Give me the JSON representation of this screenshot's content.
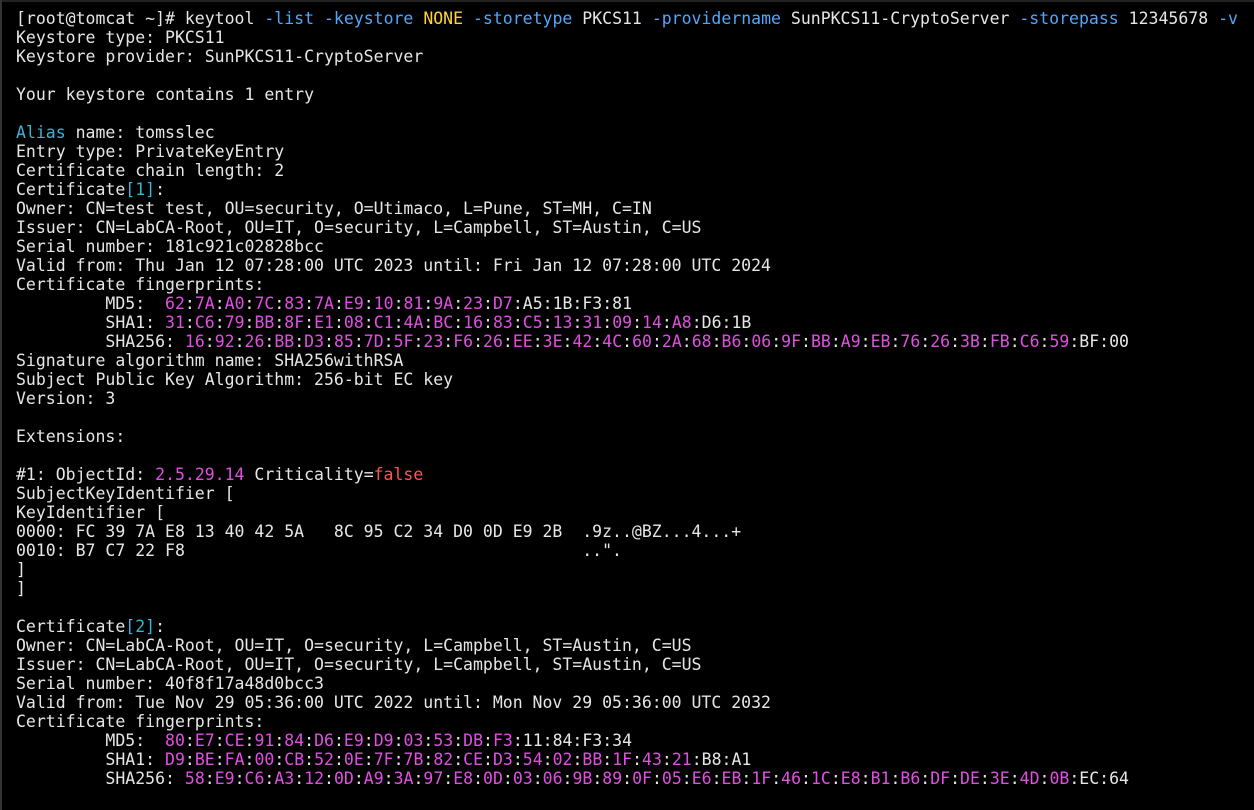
{
  "colors": {
    "background": "#000000",
    "text": "#e6e6e6",
    "option": "#4fa8ff",
    "keyword": "#38b6d8",
    "hex": "#e14fe1",
    "bool": "#ff5555",
    "value": "#ffd23a"
  },
  "terminal": {
    "lines": [
      [
        [
          "plain",
          "[root@tomcat ~]# keytool "
        ],
        [
          "blue",
          "-list -keystore "
        ],
        [
          "yellow",
          "NONE "
        ],
        [
          "blue",
          "-storetype "
        ],
        [
          "plain",
          "PKCS11 "
        ],
        [
          "blue",
          "-providername "
        ],
        [
          "plain",
          "SunPKCS11-CryptoServer "
        ],
        [
          "blue",
          "-storepass "
        ],
        [
          "plain",
          "12345678 "
        ],
        [
          "blue",
          "-v"
        ]
      ],
      [
        [
          "plain",
          "Keystore type: PKCS11"
        ]
      ],
      [
        [
          "plain",
          "Keystore provider: SunPKCS11-CryptoServer"
        ]
      ],
      [
        [
          "plain",
          ""
        ]
      ],
      [
        [
          "plain",
          "Your keystore contains 1 entry"
        ]
      ],
      [
        [
          "plain",
          ""
        ]
      ],
      [
        [
          "cyan",
          "Alias"
        ],
        [
          "plain",
          " name: tomsslec"
        ]
      ],
      [
        [
          "plain",
          "Entry type: PrivateKeyEntry"
        ]
      ],
      [
        [
          "plain",
          "Certificate chain length: 2"
        ]
      ],
      [
        [
          "plain",
          "Certificate"
        ],
        [
          "cyan",
          "[1]"
        ],
        [
          "plain",
          ":"
        ]
      ],
      [
        [
          "plain",
          "Owner: CN=test test, OU=security, O=Utimaco, L=Pune, ST=MH, C=IN"
        ]
      ],
      [
        [
          "plain",
          "Issuer: CN=LabCA-Root, OU=IT, O=security, L=Campbell, ST=Austin, C=US"
        ]
      ],
      [
        [
          "plain",
          "Serial number: 181c921c02828bcc"
        ]
      ],
      [
        [
          "plain",
          "Valid from: Thu Jan 12 07:28:00 UTC 2023 until: Fri Jan 12 07:28:00 UTC 2024"
        ]
      ],
      [
        [
          "plain",
          "Certificate fingerprints:"
        ]
      ],
      [
        [
          "plain",
          "         MD5:  "
        ],
        [
          "magenta",
          "62"
        ],
        [
          "plain",
          ":"
        ],
        [
          "magenta",
          "7A"
        ],
        [
          "plain",
          ":"
        ],
        [
          "magenta",
          "A0"
        ],
        [
          "plain",
          ":"
        ],
        [
          "magenta",
          "7C"
        ],
        [
          "plain",
          ":"
        ],
        [
          "magenta",
          "83"
        ],
        [
          "plain",
          ":"
        ],
        [
          "magenta",
          "7A"
        ],
        [
          "plain",
          ":"
        ],
        [
          "magenta",
          "E9"
        ],
        [
          "plain",
          ":"
        ],
        [
          "magenta",
          "10"
        ],
        [
          "plain",
          ":"
        ],
        [
          "magenta",
          "81"
        ],
        [
          "plain",
          ":"
        ],
        [
          "magenta",
          "9A"
        ],
        [
          "plain",
          ":"
        ],
        [
          "magenta",
          "23"
        ],
        [
          "plain",
          ":"
        ],
        [
          "magenta",
          "D7"
        ],
        [
          "plain",
          ":A5:1B:F3:81"
        ]
      ],
      [
        [
          "plain",
          "         SHA1: "
        ],
        [
          "magenta",
          "31"
        ],
        [
          "plain",
          ":"
        ],
        [
          "magenta",
          "C6"
        ],
        [
          "plain",
          ":"
        ],
        [
          "magenta",
          "79"
        ],
        [
          "plain",
          ":"
        ],
        [
          "magenta",
          "BB"
        ],
        [
          "plain",
          ":"
        ],
        [
          "magenta",
          "8F"
        ],
        [
          "plain",
          ":"
        ],
        [
          "magenta",
          "E1"
        ],
        [
          "plain",
          ":"
        ],
        [
          "magenta",
          "08"
        ],
        [
          "plain",
          ":"
        ],
        [
          "magenta",
          "C1"
        ],
        [
          "plain",
          ":"
        ],
        [
          "magenta",
          "4A"
        ],
        [
          "plain",
          ":"
        ],
        [
          "magenta",
          "BC"
        ],
        [
          "plain",
          ":"
        ],
        [
          "magenta",
          "16"
        ],
        [
          "plain",
          ":"
        ],
        [
          "magenta",
          "83"
        ],
        [
          "plain",
          ":"
        ],
        [
          "magenta",
          "C5"
        ],
        [
          "plain",
          ":"
        ],
        [
          "magenta",
          "13"
        ],
        [
          "plain",
          ":"
        ],
        [
          "magenta",
          "31"
        ],
        [
          "plain",
          ":"
        ],
        [
          "magenta",
          "09"
        ],
        [
          "plain",
          ":"
        ],
        [
          "magenta",
          "14"
        ],
        [
          "plain",
          ":"
        ],
        [
          "magenta",
          "A8"
        ],
        [
          "plain",
          ":D6:1B"
        ]
      ],
      [
        [
          "plain",
          "         SHA256: "
        ],
        [
          "magenta",
          "16"
        ],
        [
          "plain",
          ":"
        ],
        [
          "magenta",
          "92"
        ],
        [
          "plain",
          ":"
        ],
        [
          "magenta",
          "26"
        ],
        [
          "plain",
          ":"
        ],
        [
          "magenta",
          "BB"
        ],
        [
          "plain",
          ":"
        ],
        [
          "magenta",
          "D3"
        ],
        [
          "plain",
          ":"
        ],
        [
          "magenta",
          "85"
        ],
        [
          "plain",
          ":"
        ],
        [
          "magenta",
          "7D"
        ],
        [
          "plain",
          ":"
        ],
        [
          "magenta",
          "5F"
        ],
        [
          "plain",
          ":"
        ],
        [
          "magenta",
          "23"
        ],
        [
          "plain",
          ":"
        ],
        [
          "magenta",
          "F6"
        ],
        [
          "plain",
          ":"
        ],
        [
          "magenta",
          "26"
        ],
        [
          "plain",
          ":"
        ],
        [
          "magenta",
          "EE"
        ],
        [
          "plain",
          ":"
        ],
        [
          "magenta",
          "3E"
        ],
        [
          "plain",
          ":"
        ],
        [
          "magenta",
          "42"
        ],
        [
          "plain",
          ":"
        ],
        [
          "magenta",
          "4C"
        ],
        [
          "plain",
          ":"
        ],
        [
          "magenta",
          "60"
        ],
        [
          "plain",
          ":"
        ],
        [
          "magenta",
          "2A"
        ],
        [
          "plain",
          ":"
        ],
        [
          "magenta",
          "68"
        ],
        [
          "plain",
          ":"
        ],
        [
          "magenta",
          "B6"
        ],
        [
          "plain",
          ":"
        ],
        [
          "magenta",
          "06"
        ],
        [
          "plain",
          ":"
        ],
        [
          "magenta",
          "9F"
        ],
        [
          "plain",
          ":"
        ],
        [
          "magenta",
          "BB"
        ],
        [
          "plain",
          ":"
        ],
        [
          "magenta",
          "A9"
        ],
        [
          "plain",
          ":"
        ],
        [
          "magenta",
          "EB"
        ],
        [
          "plain",
          ":"
        ],
        [
          "magenta",
          "76"
        ],
        [
          "plain",
          ":"
        ],
        [
          "magenta",
          "26"
        ],
        [
          "plain",
          ":"
        ],
        [
          "magenta",
          "3B"
        ],
        [
          "plain",
          ":"
        ],
        [
          "magenta",
          "FB"
        ],
        [
          "plain",
          ":"
        ],
        [
          "magenta",
          "C6"
        ],
        [
          "plain",
          ":"
        ],
        [
          "magenta",
          "59"
        ],
        [
          "plain",
          ":BF:00"
        ]
      ],
      [
        [
          "plain",
          "Signature algorithm name: SHA256withRSA"
        ]
      ],
      [
        [
          "plain",
          "Subject Public Key Algorithm: 256-bit EC key"
        ]
      ],
      [
        [
          "plain",
          "Version: 3"
        ]
      ],
      [
        [
          "plain",
          ""
        ]
      ],
      [
        [
          "plain",
          "Extensions:"
        ]
      ],
      [
        [
          "plain",
          ""
        ]
      ],
      [
        [
          "plain",
          "#1: ObjectId: "
        ],
        [
          "magenta",
          "2.5.29.14"
        ],
        [
          "plain",
          " Criticality="
        ],
        [
          "red",
          "false"
        ]
      ],
      [
        [
          "plain",
          "SubjectKeyIdentifier ["
        ]
      ],
      [
        [
          "plain",
          "KeyIdentifier ["
        ]
      ],
      [
        [
          "plain",
          "0000: FC 39 7A E8 13 40 42 5A   8C 95 C2 34 D0 0D E9 2B  .9z..@BZ...4...+"
        ]
      ],
      [
        [
          "plain",
          "0010: B7 C7 22 F8                                        ..\"."
        ]
      ],
      [
        [
          "plain",
          "]"
        ]
      ],
      [
        [
          "plain",
          "]"
        ]
      ],
      [
        [
          "plain",
          ""
        ]
      ],
      [
        [
          "plain",
          "Certificate"
        ],
        [
          "cyan",
          "[2]"
        ],
        [
          "plain",
          ":"
        ]
      ],
      [
        [
          "plain",
          "Owner: CN=LabCA-Root, OU=IT, O=security, L=Campbell, ST=Austin, C=US"
        ]
      ],
      [
        [
          "plain",
          "Issuer: CN=LabCA-Root, OU=IT, O=security, L=Campbell, ST=Austin, C=US"
        ]
      ],
      [
        [
          "plain",
          "Serial number: 40f8f17a48d0bcc3"
        ]
      ],
      [
        [
          "plain",
          "Valid from: Tue Nov 29 05:36:00 UTC 2022 until: Mon Nov 29 05:36:00 UTC 2032"
        ]
      ],
      [
        [
          "plain",
          "Certificate fingerprints:"
        ]
      ],
      [
        [
          "plain",
          "         MD5:  "
        ],
        [
          "magenta",
          "80"
        ],
        [
          "plain",
          ":"
        ],
        [
          "magenta",
          "E7"
        ],
        [
          "plain",
          ":"
        ],
        [
          "magenta",
          "CE"
        ],
        [
          "plain",
          ":"
        ],
        [
          "magenta",
          "91"
        ],
        [
          "plain",
          ":"
        ],
        [
          "magenta",
          "84"
        ],
        [
          "plain",
          ":"
        ],
        [
          "magenta",
          "D6"
        ],
        [
          "plain",
          ":"
        ],
        [
          "magenta",
          "E9"
        ],
        [
          "plain",
          ":"
        ],
        [
          "magenta",
          "D9"
        ],
        [
          "plain",
          ":"
        ],
        [
          "magenta",
          "03"
        ],
        [
          "plain",
          ":"
        ],
        [
          "magenta",
          "53"
        ],
        [
          "plain",
          ":"
        ],
        [
          "magenta",
          "DB"
        ],
        [
          "plain",
          ":"
        ],
        [
          "magenta",
          "F3"
        ],
        [
          "plain",
          ":11:84:F3:34"
        ]
      ],
      [
        [
          "plain",
          "         SHA1: "
        ],
        [
          "magenta",
          "D9"
        ],
        [
          "plain",
          ":"
        ],
        [
          "magenta",
          "BE"
        ],
        [
          "plain",
          ":"
        ],
        [
          "magenta",
          "FA"
        ],
        [
          "plain",
          ":"
        ],
        [
          "magenta",
          "00"
        ],
        [
          "plain",
          ":"
        ],
        [
          "magenta",
          "CB"
        ],
        [
          "plain",
          ":"
        ],
        [
          "magenta",
          "52"
        ],
        [
          "plain",
          ":"
        ],
        [
          "magenta",
          "0E"
        ],
        [
          "plain",
          ":"
        ],
        [
          "magenta",
          "7F"
        ],
        [
          "plain",
          ":"
        ],
        [
          "magenta",
          "7B"
        ],
        [
          "plain",
          ":"
        ],
        [
          "magenta",
          "82"
        ],
        [
          "plain",
          ":"
        ],
        [
          "magenta",
          "CE"
        ],
        [
          "plain",
          ":"
        ],
        [
          "magenta",
          "D3"
        ],
        [
          "plain",
          ":"
        ],
        [
          "magenta",
          "54"
        ],
        [
          "plain",
          ":"
        ],
        [
          "magenta",
          "02"
        ],
        [
          "plain",
          ":"
        ],
        [
          "magenta",
          "BB"
        ],
        [
          "plain",
          ":"
        ],
        [
          "magenta",
          "1F"
        ],
        [
          "plain",
          ":"
        ],
        [
          "magenta",
          "43"
        ],
        [
          "plain",
          ":"
        ],
        [
          "magenta",
          "21"
        ],
        [
          "plain",
          ":B8:A1"
        ]
      ],
      [
        [
          "plain",
          "         SHA256: "
        ],
        [
          "magenta",
          "58"
        ],
        [
          "plain",
          ":"
        ],
        [
          "magenta",
          "E9"
        ],
        [
          "plain",
          ":"
        ],
        [
          "magenta",
          "C6"
        ],
        [
          "plain",
          ":"
        ],
        [
          "magenta",
          "A3"
        ],
        [
          "plain",
          ":"
        ],
        [
          "magenta",
          "12"
        ],
        [
          "plain",
          ":"
        ],
        [
          "magenta",
          "0D"
        ],
        [
          "plain",
          ":"
        ],
        [
          "magenta",
          "A9"
        ],
        [
          "plain",
          ":"
        ],
        [
          "magenta",
          "3A"
        ],
        [
          "plain",
          ":"
        ],
        [
          "magenta",
          "97"
        ],
        [
          "plain",
          ":"
        ],
        [
          "magenta",
          "E8"
        ],
        [
          "plain",
          ":"
        ],
        [
          "magenta",
          "0D"
        ],
        [
          "plain",
          ":"
        ],
        [
          "magenta",
          "03"
        ],
        [
          "plain",
          ":"
        ],
        [
          "magenta",
          "06"
        ],
        [
          "plain",
          ":"
        ],
        [
          "magenta",
          "9B"
        ],
        [
          "plain",
          ":"
        ],
        [
          "magenta",
          "89"
        ],
        [
          "plain",
          ":"
        ],
        [
          "magenta",
          "0F"
        ],
        [
          "plain",
          ":"
        ],
        [
          "magenta",
          "05"
        ],
        [
          "plain",
          ":"
        ],
        [
          "magenta",
          "E6"
        ],
        [
          "plain",
          ":"
        ],
        [
          "magenta",
          "EB"
        ],
        [
          "plain",
          ":"
        ],
        [
          "magenta",
          "1F"
        ],
        [
          "plain",
          ":"
        ],
        [
          "magenta",
          "46"
        ],
        [
          "plain",
          ":"
        ],
        [
          "magenta",
          "1C"
        ],
        [
          "plain",
          ":"
        ],
        [
          "magenta",
          "E8"
        ],
        [
          "plain",
          ":"
        ],
        [
          "magenta",
          "B1"
        ],
        [
          "plain",
          ":"
        ],
        [
          "magenta",
          "B6"
        ],
        [
          "plain",
          ":"
        ],
        [
          "magenta",
          "DF"
        ],
        [
          "plain",
          ":"
        ],
        [
          "magenta",
          "DE"
        ],
        [
          "plain",
          ":"
        ],
        [
          "magenta",
          "3E"
        ],
        [
          "plain",
          ":"
        ],
        [
          "magenta",
          "4D"
        ],
        [
          "plain",
          ":"
        ],
        [
          "magenta",
          "0B"
        ],
        [
          "plain",
          ":EC:64"
        ]
      ]
    ]
  }
}
